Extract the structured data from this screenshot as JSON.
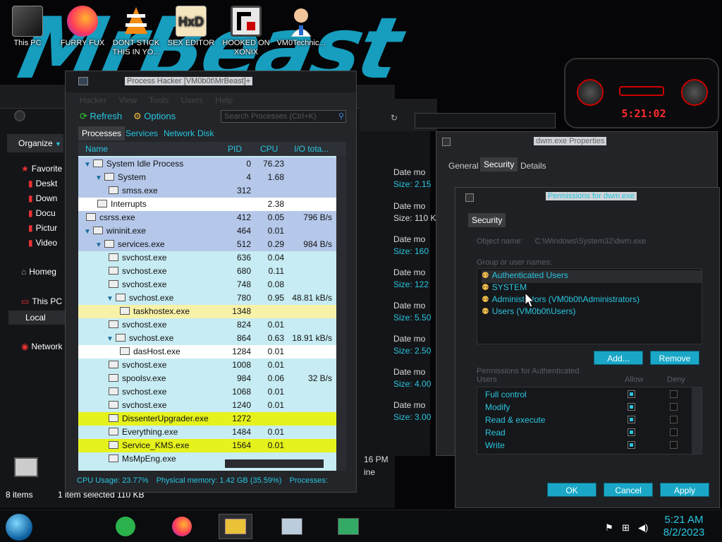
{
  "desktop": {
    "icons": [
      {
        "label": "This PC",
        "icon": "this-pc-icon"
      },
      {
        "label": "FURRY FUX",
        "icon": "firefox-icon"
      },
      {
        "label": "DONT STICK THIS IN YO...",
        "icon": "vlc-icon"
      },
      {
        "label": "SEX EDITOR",
        "icon": "hxd-icon"
      },
      {
        "label": "HOOKED ON XONIX",
        "icon": "xonix-icon"
      },
      {
        "label": "VM0Technic...",
        "icon": "doctor-icon"
      }
    ],
    "clock_widget": "5:21:02"
  },
  "explorer": {
    "organize": "Organize",
    "nav": [
      "Favorite",
      "Deskt",
      "Down",
      "Docu",
      "Pictur",
      "Video",
      "Homeg",
      "This PC",
      "Local",
      "Network"
    ],
    "files": [
      {
        "date": "Date mo",
        "size": "Size: 2.15"
      },
      {
        "date": "Date mo",
        "size": "Size: 110 K"
      },
      {
        "date": "Date mo",
        "size": "Size: 160 "
      },
      {
        "date": "Date mo",
        "size": "Size: 122 "
      },
      {
        "date": "Date mo",
        "size": "Size: 5.50"
      },
      {
        "date": "Date mo",
        "size": "Size: 2.50"
      },
      {
        "date": "Date mo",
        "size": "Size: 4.00"
      },
      {
        "date": "Date mo",
        "size": "Size: 3.00"
      }
    ],
    "time_fragment": "16 PM",
    "line_fragment": "ine",
    "status_items": "8 items",
    "status_selected": "1 item selected  110 KB"
  },
  "process_hacker": {
    "title": "Process Hacker [VM0b0t\\MrBeast]+",
    "menu": [
      "Hacker",
      "View",
      "Tools",
      "Users",
      "Help"
    ],
    "refresh": "Refresh",
    "options": "Options",
    "search_placeholder": "Search Processes (Ctrl+K)",
    "tabs": [
      "Processes",
      "Services",
      "Network",
      "Disk"
    ],
    "columns": [
      "Name",
      "PID",
      "CPU",
      "I/O tota..."
    ],
    "rows": [
      {
        "name": "System Idle Process",
        "pid": "0",
        "cpu": "76.23",
        "io": "",
        "indent": 0,
        "chev": true,
        "bg": "#b5c8ea"
      },
      {
        "name": "System",
        "pid": "4",
        "cpu": "1.68",
        "io": "",
        "indent": 1,
        "chev": true,
        "bg": "#b5c8ea"
      },
      {
        "name": "smss.exe",
        "pid": "312",
        "cpu": "",
        "io": "",
        "indent": 2,
        "chev": false,
        "bg": "#b5c8ea"
      },
      {
        "name": "Interrupts",
        "pid": "",
        "cpu": "2.38",
        "io": "",
        "indent": 1,
        "chev": false,
        "bg": "#ffffff"
      },
      {
        "name": "csrss.exe",
        "pid": "412",
        "cpu": "0.05",
        "io": "796 B/s",
        "indent": 0,
        "chev": false,
        "bg": "#b5c8ea"
      },
      {
        "name": "wininit.exe",
        "pid": "464",
        "cpu": "0.01",
        "io": "",
        "indent": 0,
        "chev": true,
        "bg": "#b5c8ea"
      },
      {
        "name": "services.exe",
        "pid": "512",
        "cpu": "0.29",
        "io": "984 B/s",
        "indent": 1,
        "chev": true,
        "bg": "#b5c8ea"
      },
      {
        "name": "svchost.exe",
        "pid": "636",
        "cpu": "0.04",
        "io": "",
        "indent": 2,
        "chev": false,
        "bg": "#c7ecf3"
      },
      {
        "name": "svchost.exe",
        "pid": "680",
        "cpu": "0.11",
        "io": "",
        "indent": 2,
        "chev": false,
        "bg": "#c7ecf3"
      },
      {
        "name": "svchost.exe",
        "pid": "748",
        "cpu": "0.08",
        "io": "",
        "indent": 2,
        "chev": false,
        "bg": "#c7ecf3"
      },
      {
        "name": "svchost.exe",
        "pid": "780",
        "cpu": "0.95",
        "io": "48.81 kB/s",
        "indent": 2,
        "chev": true,
        "bg": "#c7ecf3"
      },
      {
        "name": "taskhostex.exe",
        "pid": "1348",
        "cpu": "",
        "io": "",
        "indent": 3,
        "chev": false,
        "bg": "#f8f2a8"
      },
      {
        "name": "svchost.exe",
        "pid": "824",
        "cpu": "0.01",
        "io": "",
        "indent": 2,
        "chev": false,
        "bg": "#c7ecf3"
      },
      {
        "name": "svchost.exe",
        "pid": "864",
        "cpu": "0.63",
        "io": "18.91 kB/s",
        "indent": 2,
        "chev": true,
        "bg": "#c7ecf3"
      },
      {
        "name": "dasHost.exe",
        "pid": "1284",
        "cpu": "0.01",
        "io": "",
        "indent": 3,
        "chev": false,
        "bg": "#ffffff"
      },
      {
        "name": "svchost.exe",
        "pid": "1008",
        "cpu": "0.01",
        "io": "",
        "indent": 2,
        "chev": false,
        "bg": "#c7ecf3"
      },
      {
        "name": "spoolsv.exe",
        "pid": "984",
        "cpu": "0.06",
        "io": "32 B/s",
        "indent": 2,
        "chev": false,
        "bg": "#c7ecf3"
      },
      {
        "name": "svchost.exe",
        "pid": "1068",
        "cpu": "0.01",
        "io": "",
        "indent": 2,
        "chev": false,
        "bg": "#c7ecf3"
      },
      {
        "name": "svchost.exe",
        "pid": "1240",
        "cpu": "0.01",
        "io": "",
        "indent": 2,
        "chev": false,
        "bg": "#c7ecf3"
      },
      {
        "name": "DissenterUpgrader.exe",
        "pid": "1272",
        "cpu": "",
        "io": "",
        "indent": 2,
        "chev": false,
        "bg": "#e6f21c"
      },
      {
        "name": "Everything.exe",
        "pid": "1484",
        "cpu": "0.01",
        "io": "",
        "indent": 2,
        "chev": false,
        "bg": "#c7ecf3"
      },
      {
        "name": "Service_KMS.exe",
        "pid": "1564",
        "cpu": "0.01",
        "io": "",
        "indent": 2,
        "chev": false,
        "bg": "#e6f21c"
      },
      {
        "name": "MsMpEng.exe",
        "pid": "",
        "cpu": "",
        "io": "",
        "indent": 2,
        "chev": false,
        "bg": "#c7ecf3"
      }
    ],
    "status_cpu": "CPU Usage: 23.77%",
    "status_mem": "Physical memory: 1.42 GB (35.59%)",
    "status_proc": "Processes:"
  },
  "properties": {
    "title": "dwm.exe Properties",
    "tabs": [
      "General",
      "Security",
      "Details"
    ]
  },
  "permissions": {
    "title": "Permissions for dwm.exe",
    "tab": "Security",
    "object_name_label": "Object name:",
    "object_name_value": "C:\\Windows\\System32\\dwm.exe",
    "group_label": "Group or user names:",
    "users": [
      "Authenticated Users",
      "SYSTEM",
      "Administrators (VM0b0t\\Administrators)",
      "Users (VM0b0t\\Users)"
    ],
    "add": "Add...",
    "remove": "Remove",
    "perm_label": "Permissions for Authenticated Users",
    "allow": "Allow",
    "deny": "Deny",
    "perms": [
      {
        "name": "Full control",
        "allow": true
      },
      {
        "name": "Modify",
        "allow": true
      },
      {
        "name": "Read & execute",
        "allow": true
      },
      {
        "name": "Read",
        "allow": true
      },
      {
        "name": "Write",
        "allow": true
      }
    ],
    "ok": "OK",
    "cancel": "Cancel",
    "apply": "Apply"
  },
  "taskbar": {
    "time": "5:21 AM",
    "date": "8/2/2023"
  }
}
